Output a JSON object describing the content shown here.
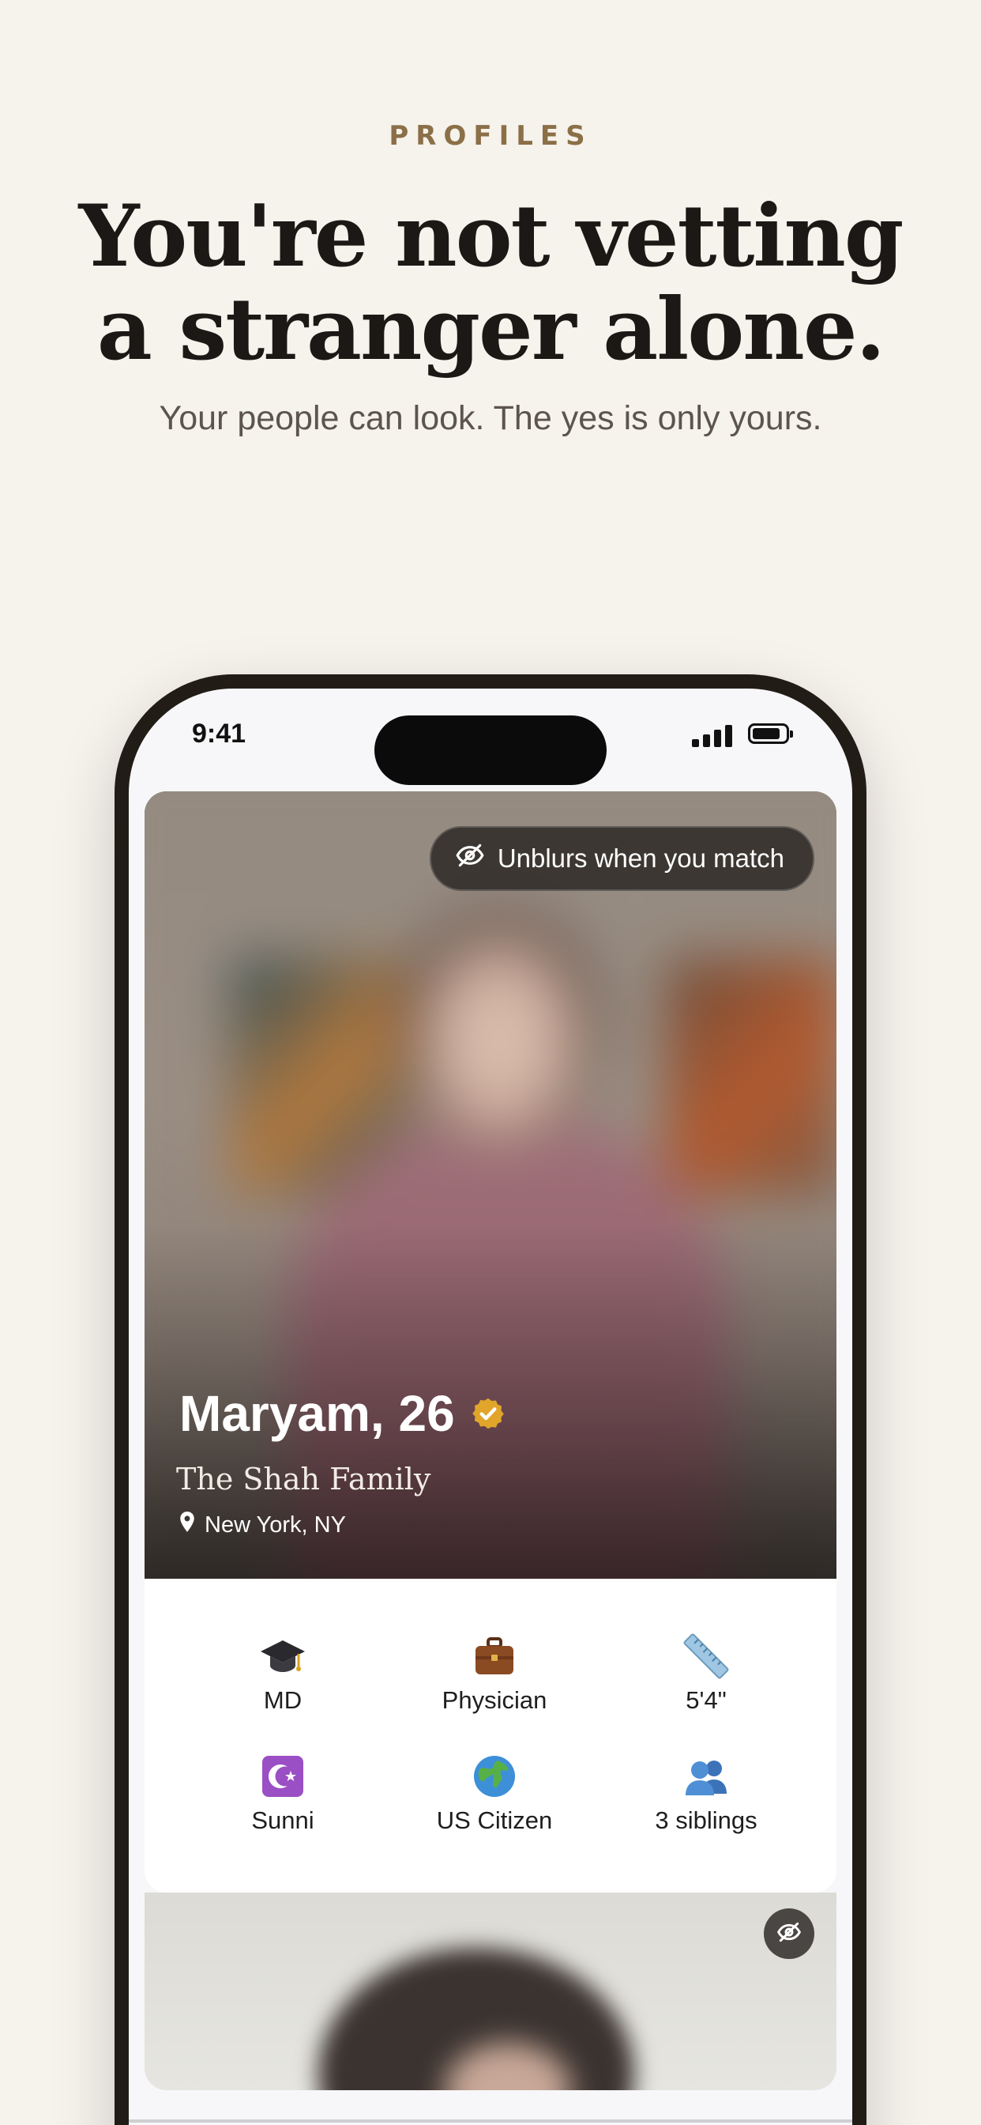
{
  "section": {
    "eyebrow": "PROFILES",
    "headline_line1": "You're not vetting",
    "headline_line2": "a stranger alone.",
    "subhead": "Your people can look. The yes is only yours."
  },
  "status_bar": {
    "time": "9:41"
  },
  "profile": {
    "blur_notice": "Unblurs when you match",
    "name_age": "Maryam, 26",
    "family": "The Shah Family",
    "location": "New York, NY",
    "verified_icon": "verified-badge-icon",
    "details": [
      {
        "icon": "graduation-cap-icon",
        "label": "MD"
      },
      {
        "icon": "briefcase-icon",
        "label": "Physician"
      },
      {
        "icon": "ruler-icon",
        "label": "5'4\""
      },
      {
        "icon": "star-and-crescent-icon",
        "label": "Sunni"
      },
      {
        "icon": "globe-icon",
        "label": "US Citizen"
      },
      {
        "icon": "people-icon",
        "label": "3 siblings"
      }
    ]
  },
  "colors": {
    "background": "#f6f2ec",
    "eyebrow": "#8b6f47",
    "phone_frame": "#221c17",
    "verified": "#e0a52a"
  }
}
